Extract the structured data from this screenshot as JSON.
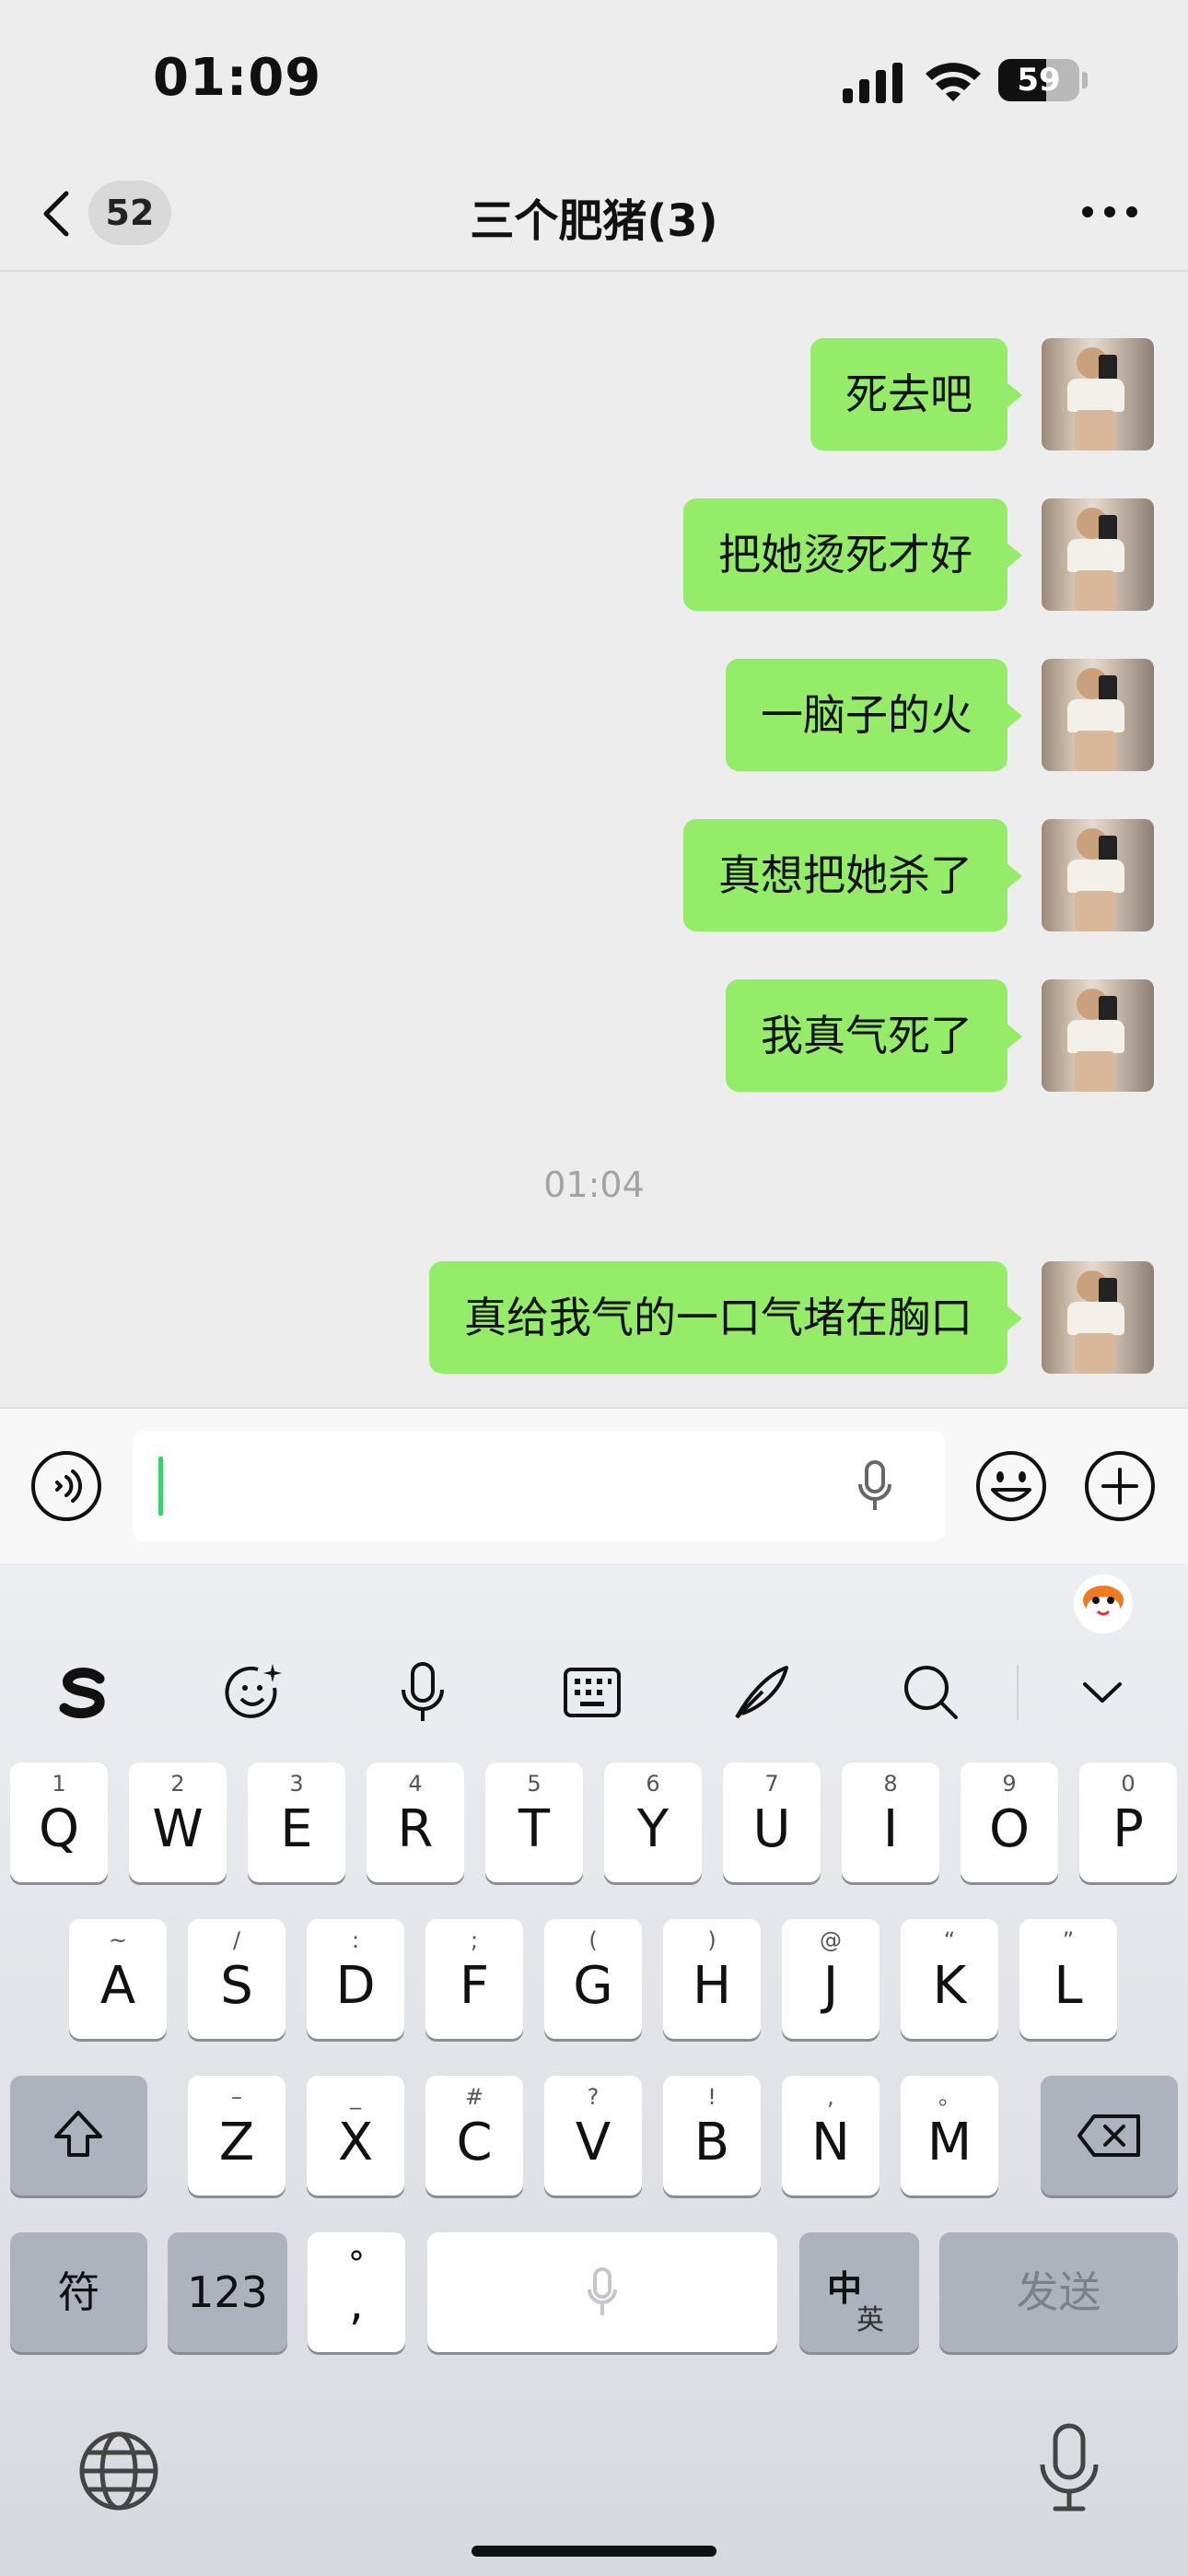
{
  "status_bar": {
    "time": "01:09",
    "battery": "59",
    "battery_level": 0.59
  },
  "nav": {
    "back_count": "52",
    "title": "三个肥猪(3)"
  },
  "messages": [
    {
      "text": "死去吧"
    },
    {
      "text": "把她烫死才好"
    },
    {
      "text": "一脑子的火"
    },
    {
      "text": "真想把她杀了"
    },
    {
      "text": "我真气死了"
    },
    {
      "timestamp": "01:04"
    },
    {
      "text": "真给我气的一口气堵在胸口"
    }
  ],
  "input": {
    "value": "",
    "placeholder": ""
  },
  "icons": {
    "voice": "voice-icon",
    "mic": "microphone-icon",
    "emoji": "smiley-icon",
    "plus": "plus-icon",
    "back": "chevron-left-icon",
    "more": "more-icon",
    "globe": "globe-icon",
    "dictation": "microphone-icon"
  },
  "keyboard": {
    "toolbar": [
      "sogou-logo-icon",
      "emoji-sparkle-icon",
      "microphone-icon",
      "keyboard-icon",
      "handwriting-pen-icon",
      "search-icon",
      "chevron-down-icon"
    ],
    "row1": [
      {
        "key": "Q",
        "hint": "1"
      },
      {
        "key": "W",
        "hint": "2"
      },
      {
        "key": "E",
        "hint": "3"
      },
      {
        "key": "R",
        "hint": "4"
      },
      {
        "key": "T",
        "hint": "5"
      },
      {
        "key": "Y",
        "hint": "6"
      },
      {
        "key": "U",
        "hint": "7"
      },
      {
        "key": "I",
        "hint": "8"
      },
      {
        "key": "O",
        "hint": "9"
      },
      {
        "key": "P",
        "hint": "0"
      }
    ],
    "row2": [
      {
        "key": "A",
        "hint": "~"
      },
      {
        "key": "S",
        "hint": "/"
      },
      {
        "key": "D",
        "hint": ":"
      },
      {
        "key": "F",
        "hint": ";"
      },
      {
        "key": "G",
        "hint": "("
      },
      {
        "key": "H",
        "hint": ")"
      },
      {
        "key": "J",
        "hint": "@"
      },
      {
        "key": "K",
        "hint": "“"
      },
      {
        "key": "L",
        "hint": "”"
      }
    ],
    "row3": [
      {
        "key": "Z",
        "hint": "–"
      },
      {
        "key": "X",
        "hint": "_"
      },
      {
        "key": "C",
        "hint": "#"
      },
      {
        "key": "V",
        "hint": "?"
      },
      {
        "key": "B",
        "hint": "!"
      },
      {
        "key": "N",
        "hint": ","
      },
      {
        "key": "M",
        "hint": "。"
      }
    ],
    "symbols": "符",
    "numbers": "123",
    "comma_top": "°",
    "comma_main": ",",
    "lang_main": "中",
    "lang_alt": "英",
    "send": "发送"
  }
}
